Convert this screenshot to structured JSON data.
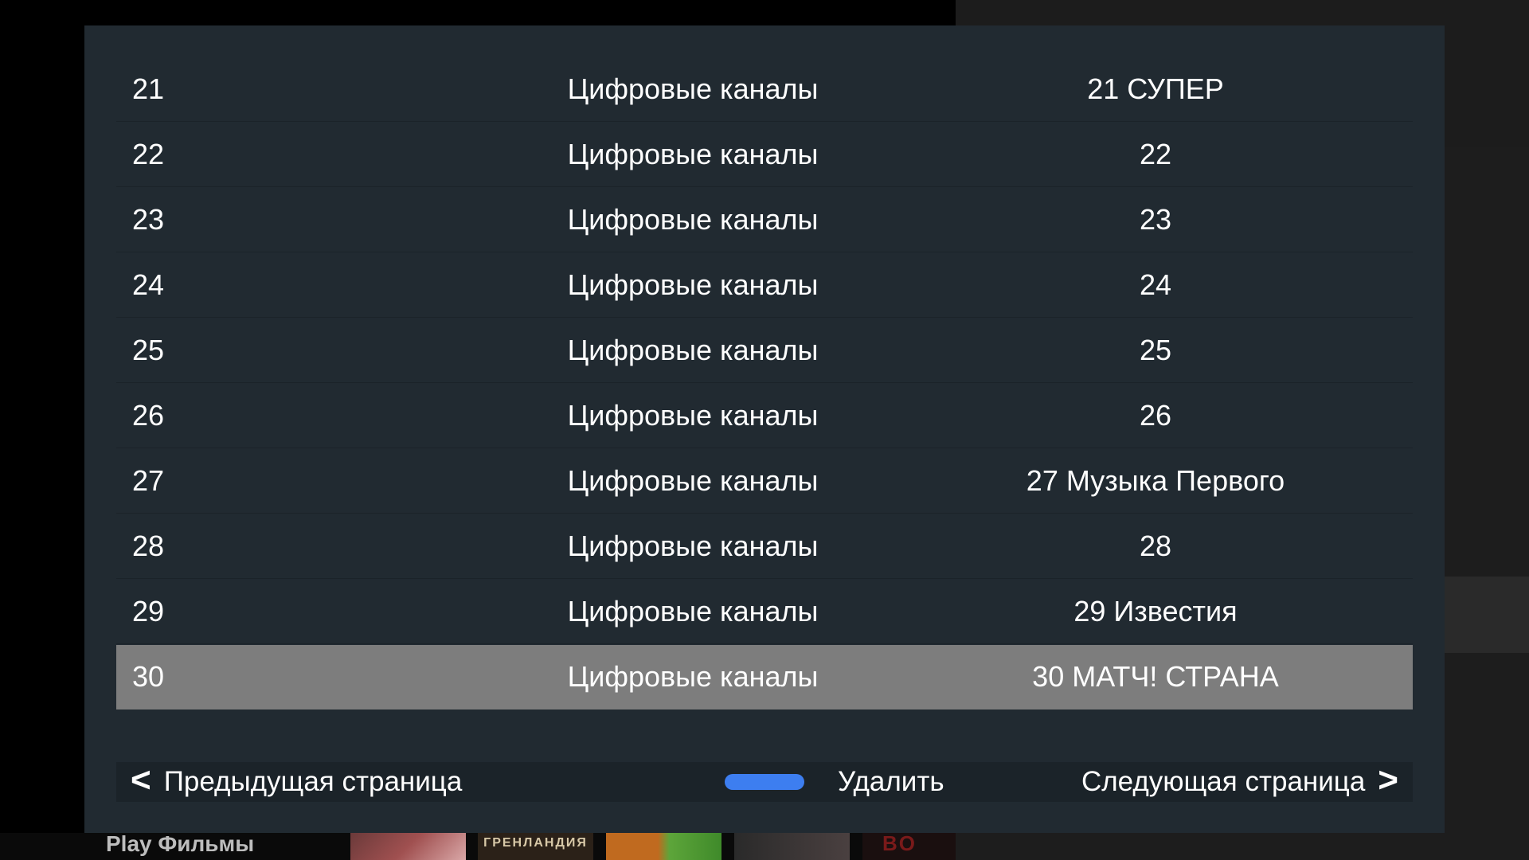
{
  "channels": [
    {
      "number": "21",
      "group": "Цифровые каналы",
      "name": "21 СУПЕР"
    },
    {
      "number": "22",
      "group": "Цифровые каналы",
      "name": "22"
    },
    {
      "number": "23",
      "group": "Цифровые каналы",
      "name": "23"
    },
    {
      "number": "24",
      "group": "Цифровые каналы",
      "name": "24"
    },
    {
      "number": "25",
      "group": "Цифровые каналы",
      "name": "25"
    },
    {
      "number": "26",
      "group": "Цифровые каналы",
      "name": "26"
    },
    {
      "number": "27",
      "group": "Цифровые каналы",
      "name": "27 Музыка Первого"
    },
    {
      "number": "28",
      "group": "Цифровые каналы",
      "name": "28"
    },
    {
      "number": "29",
      "group": "Цифровые каналы",
      "name": "29 Известия"
    },
    {
      "number": "30",
      "group": "Цифровые каналы",
      "name": "30 МАТЧ! СТРАНА",
      "selected": true
    }
  ],
  "footer": {
    "prev_label": "Предыдущая страница",
    "delete_label": "Удалить",
    "next_label": "Следующая страница",
    "prev_glyph": "<",
    "next_glyph": ">",
    "delete_key_color": "#3d7ef0"
  },
  "background": {
    "shelf_title": "Play Фильмы",
    "thumb_2_text": "ГРЕНЛАНДИЯ",
    "thumb_5_text": "BO"
  },
  "colors": {
    "dialog_bg": "#212a31",
    "selected_row_bg": "#7d7d7d",
    "text": "#ffffff"
  }
}
